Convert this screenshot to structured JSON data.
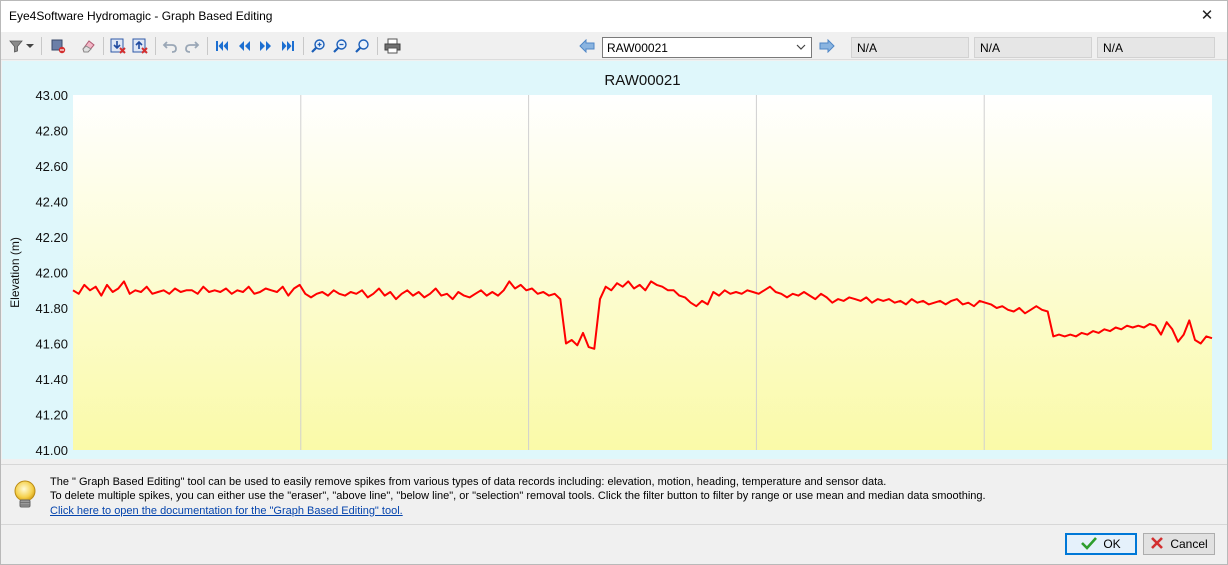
{
  "window": {
    "title": "Eye4Software Hydromagic - Graph Based Editing",
    "close_glyph": "✕"
  },
  "toolbar": {
    "icons": [
      "filter-icon",
      "dropdown-arrow-icon",
      "delete-selection-icon",
      "eraser-icon",
      "delete-below-icon",
      "delete-above-icon",
      "undo-icon",
      "redo-icon",
      "first-record-icon",
      "previous-record-icon",
      "next-record-icon",
      "last-record-icon",
      "zoom-in-icon",
      "zoom-out-icon",
      "zoom-reset-icon",
      "print-icon"
    ],
    "record_select": {
      "value": "RAW00021"
    },
    "status_fields": [
      "N/A",
      "N/A",
      "N/A"
    ]
  },
  "chart_data": {
    "type": "line",
    "title": "RAW00021",
    "ylabel": "Elevation (m)",
    "xlabel": "",
    "ylim": [
      41.0,
      43.0
    ],
    "yticks": [
      "43.00",
      "42.80",
      "42.60",
      "42.40",
      "42.20",
      "42.00",
      "41.80",
      "41.60",
      "41.40",
      "41.20",
      "41.00"
    ],
    "x_gridlines": 5,
    "grid": true,
    "line_color": "#ff0000",
    "plot_gradient": [
      "#ffffff",
      "#fafaa8"
    ],
    "series": [
      {
        "values": [
          41.9,
          41.88,
          41.93,
          41.9,
          41.92,
          41.87,
          41.93,
          41.89,
          41.91,
          41.95,
          41.88,
          41.9,
          41.89,
          41.92,
          41.88,
          41.89,
          41.9,
          41.88,
          41.91,
          41.89,
          41.9,
          41.9,
          41.88,
          41.92,
          41.89,
          41.9,
          41.89,
          41.91,
          41.88,
          41.9,
          41.89,
          41.92,
          41.88,
          41.89,
          41.91,
          41.9,
          41.89,
          41.92,
          41.87,
          41.91,
          41.93,
          41.88,
          41.86,
          41.88,
          41.89,
          41.87,
          41.9,
          41.88,
          41.87,
          41.89,
          41.88,
          41.9,
          41.86,
          41.88,
          41.91,
          41.87,
          41.89,
          41.85,
          41.88,
          41.9,
          41.87,
          41.89,
          41.86,
          41.88,
          41.91,
          41.87,
          41.88,
          41.85,
          41.89,
          41.87,
          41.86,
          41.88,
          41.9,
          41.87,
          41.89,
          41.87,
          41.9,
          41.95,
          41.91,
          41.93,
          41.9,
          41.91,
          41.88,
          41.89,
          41.87,
          41.88,
          41.85,
          41.6,
          41.62,
          41.59,
          41.66,
          41.58,
          41.57,
          41.85,
          41.92,
          41.9,
          41.94,
          41.92,
          41.95,
          41.91,
          41.93,
          41.9,
          41.95,
          41.93,
          41.92,
          41.9,
          41.9,
          41.87,
          41.86,
          41.83,
          41.81,
          41.84,
          41.82,
          41.89,
          41.87,
          41.9,
          41.88,
          41.89,
          41.88,
          41.9,
          41.89,
          41.88,
          41.9,
          41.92,
          41.89,
          41.88,
          41.86,
          41.88,
          41.87,
          41.89,
          41.87,
          41.85,
          41.88,
          41.86,
          41.83,
          41.85,
          41.84,
          41.86,
          41.85,
          41.84,
          41.86,
          41.83,
          41.85,
          41.84,
          41.85,
          41.83,
          41.84,
          41.82,
          41.85,
          41.83,
          41.84,
          41.82,
          41.83,
          41.84,
          41.82,
          41.84,
          41.85,
          41.82,
          41.83,
          41.81,
          41.84,
          41.83,
          41.82,
          41.8,
          41.81,
          41.79,
          41.78,
          41.8,
          41.77,
          41.79,
          41.81,
          41.79,
          41.78,
          41.64,
          41.65,
          41.64,
          41.65,
          41.64,
          41.66,
          41.65,
          41.67,
          41.66,
          41.68,
          41.67,
          41.69,
          41.68,
          41.7,
          41.69,
          41.7,
          41.69,
          41.71,
          41.7,
          41.65,
          41.72,
          41.68,
          41.61,
          41.65,
          41.73,
          41.62,
          41.6,
          41.64,
          41.63
        ]
      }
    ]
  },
  "info": {
    "line1": "The \" Graph Based Editing\" tool can be used to easily remove spikes from various types of data records including: elevation, motion, heading, temperature and sensor data.",
    "line2": "To delete multiple spikes, you can either use the \"eraser\", \"above line\", \"below line\", or \"selection\" removal tools. Click the filter button to filter by range or use mean and median data smoothing.",
    "link": "Click here to open the documentation for the \"Graph Based Editing\" tool."
  },
  "buttons": {
    "ok": "OK",
    "cancel": "Cancel"
  }
}
